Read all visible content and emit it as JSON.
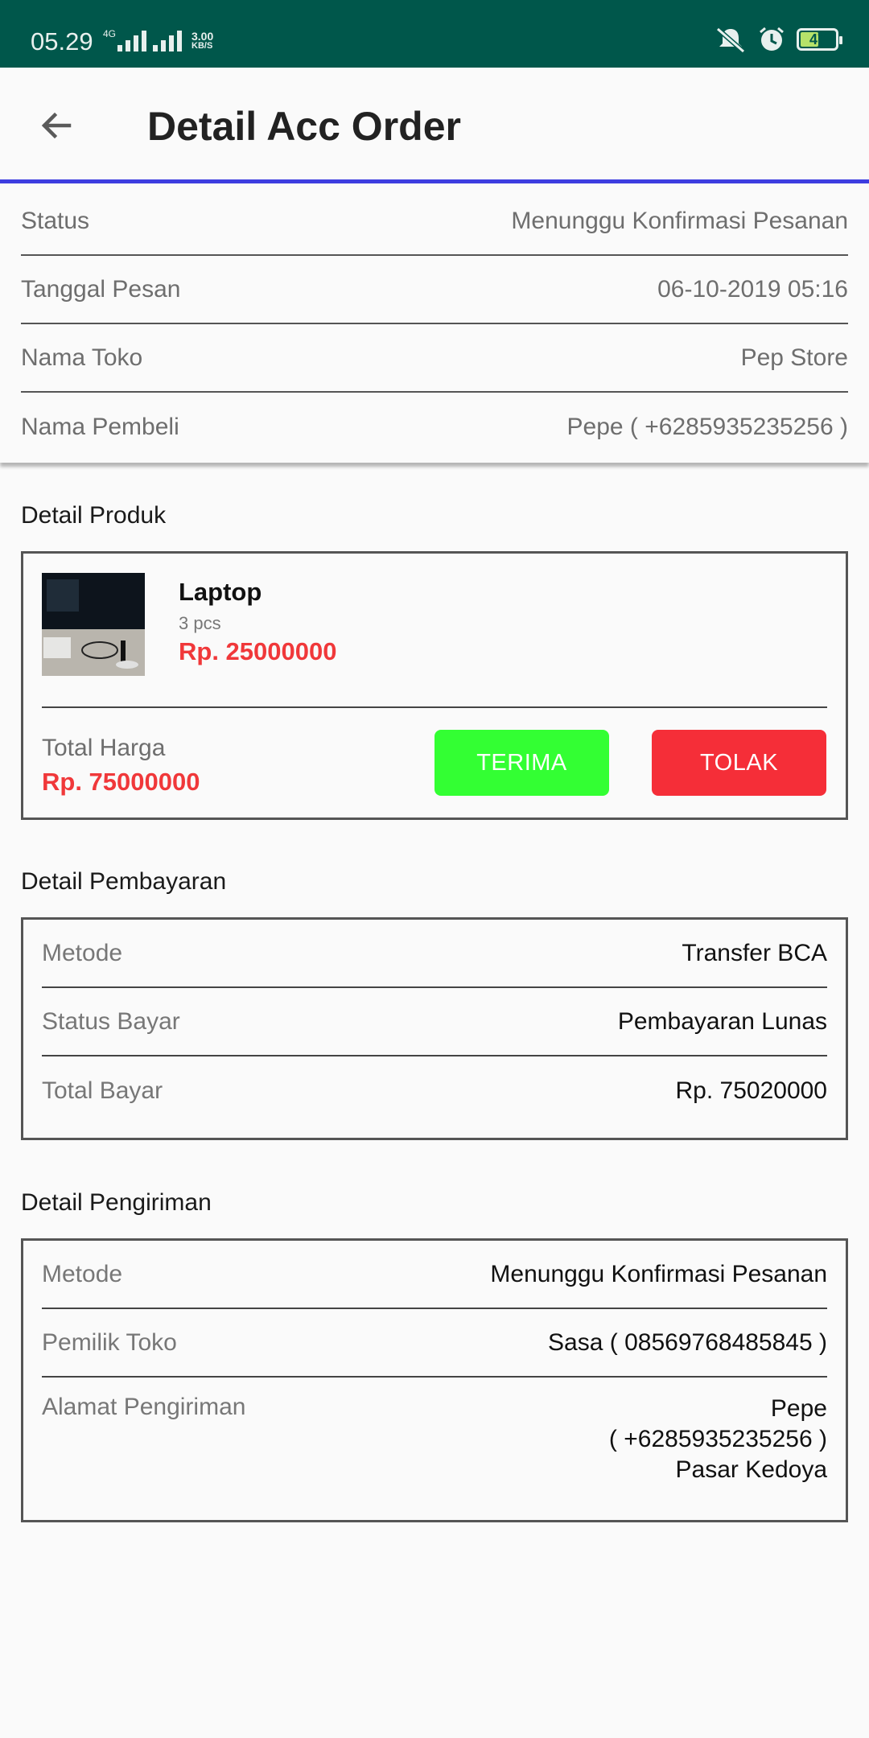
{
  "status_bar": {
    "time": "05.29",
    "network": "4G",
    "speed": "3.00",
    "speed_unit": "KB/S",
    "battery": "47"
  },
  "toolbar": {
    "title": "Detail Acc Order",
    "back_icon": "arrow-back-icon"
  },
  "order_info": [
    {
      "label": "Status",
      "value": "Menunggu Konfirmasi Pesanan"
    },
    {
      "label": "Tanggal Pesan",
      "value": "06-10-2019 05:16"
    },
    {
      "label": "Nama Toko",
      "value": "Pep Store"
    },
    {
      "label": "Nama Pembeli",
      "value": "Pepe ( +6285935235256 )"
    }
  ],
  "product_section": {
    "title": "Detail Produk",
    "product": {
      "name": "Laptop",
      "qty": "3 pcs",
      "price": "Rp. 25000000"
    },
    "total_label": "Total Harga",
    "total_value": "Rp. 75000000",
    "accept_label": "TERIMA",
    "reject_label": "TOLAK"
  },
  "payment_section": {
    "title": "Detail Pembayaran",
    "rows": [
      {
        "label": "Metode",
        "value": "Transfer BCA"
      },
      {
        "label": "Status Bayar",
        "value": "Pembayaran Lunas"
      },
      {
        "label": "Total Bayar",
        "value": "Rp. 75020000"
      }
    ]
  },
  "shipping_section": {
    "title": "Detail Pengiriman",
    "rows": [
      {
        "label": "Metode",
        "value": "Menunggu Konfirmasi Pesanan"
      },
      {
        "label": "Pemilik Toko",
        "value": "Sasa ( 08569768485845 )"
      }
    ],
    "address_label": "Alamat Pengiriman",
    "address_lines": [
      "Pepe",
      "( +6285935235256 )",
      "Pasar Kedoya"
    ]
  },
  "colors": {
    "status_bar": "#00574b",
    "accent_line": "#3d3de0",
    "price_red": "#f0383a",
    "accept_green": "#33ff33",
    "reject_red": "#f52e38"
  }
}
